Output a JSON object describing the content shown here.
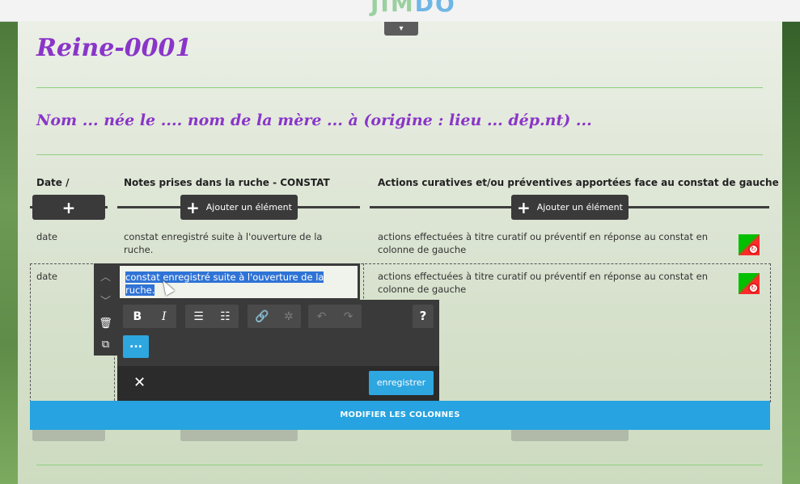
{
  "header": {
    "logo": "JIMDO",
    "logo_parts": [
      "JI",
      "M",
      "D",
      "O"
    ]
  },
  "page": {
    "title": "Reine-0001",
    "subtitle": "Nom ... née le ....  nom de la mère ... à (origine : lieu ... dép.nt) ..."
  },
  "table": {
    "columns": [
      {
        "header": "Date /",
        "add_label": ""
      },
      {
        "header": "Notes prises dans la ruche - CONSTAT",
        "add_label": "Ajouter un élément"
      },
      {
        "header": "Actions curatives et/ou préventives apportées face au constat de gauche",
        "add_label": "Ajouter un élément"
      }
    ],
    "rows": [
      {
        "date": "date",
        "notes": "constat enregistré suite à l'ouverture de la ruche.",
        "actions": "actions effectuées à titre curatif ou préventif en réponse au constat en colonne de gauche"
      },
      {
        "date": "date",
        "notes": "constat enregistré suite à l'ouverture de la ruche.",
        "actions": "actions effectuées à titre curatif ou préventif en réponse au constat en colonne de gauche"
      }
    ]
  },
  "editor": {
    "selected_text_line1": "constat enregistré suite à l'ouverture de la",
    "selected_text_line2": "ruche.",
    "more_label": "...",
    "help_label": "?",
    "close_label": "✕",
    "save_label": "enregistrer"
  },
  "modify_columns_label": "MODIFIER LES COLONNES",
  "colors": {
    "accent": "#26a3e0",
    "title": "#8a35c9",
    "divider": "#8fcf7d",
    "toolbar": "#3a3a3a"
  }
}
